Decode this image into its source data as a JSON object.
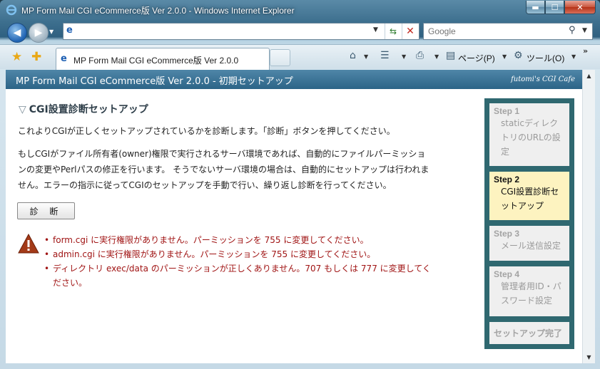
{
  "window": {
    "title": "MP Form Mail CGI eCommerce版 Ver 2.0.0 - Windows Internet Explorer",
    "controls": {
      "minimize": "▬",
      "maximize": "☐",
      "close": "✕"
    }
  },
  "nav": {
    "back_icon": "◀",
    "forward_icon": "▶",
    "address": {
      "value": ""
    },
    "search": {
      "placeholder": "Google"
    }
  },
  "tab": {
    "title": "MP Form Mail CGI eCommerce版 Ver 2.0.0"
  },
  "commands": {
    "page": "ページ(P)",
    "tools": "ツール(O)"
  },
  "banner": {
    "title": "MP Form Mail CGI eCommerce版 Ver 2.0.0 - 初期セットアップ",
    "brand": "futomi's CGI Cafe"
  },
  "main": {
    "heading": "CGI設置診断セットアップ",
    "intro": "これよりCGIが正しくセットアップされているかを診断します。「診断」ボタンを押してください。",
    "explanation_lines": [
      "もしCGIがファイル所有者(owner)権限で実行されるサーバ環境であれば、自動的にファイルパーミッショ",
      "ンの変更やPerlパスの修正を行います。 そうでないサーバ環境の場合は、自動的にセットアップは行われま",
      "せん。エラーの指示に従ってCGIのセットアップを手動で行い、繰り返し診断を行ってください。"
    ],
    "diagnose_button": "診 断",
    "errors": [
      "form.cgi に実行権限がありません。パーミッションを 755 に変更してください。",
      "admin.cgi に実行権限がありません。パーミッションを 755 に変更してください。",
      "ディレクトリ exec/data のパーミッションが正しくありません。707 もしくは 777 に変更してく",
      "ださい。"
    ]
  },
  "steps": [
    {
      "num": "Step 1",
      "lines": [
        "staticディレク",
        "トリのURLの設",
        "定"
      ],
      "active": false
    },
    {
      "num": "Step 2",
      "lines": [
        "CGI設置診断セ",
        "ットアップ"
      ],
      "active": true
    },
    {
      "num": "Step 3",
      "lines": [
        "メール送信設定"
      ],
      "active": false
    },
    {
      "num": "Step 4",
      "lines": [
        "管理者用ID・パ",
        "スワード設定"
      ],
      "active": false
    },
    {
      "num": "セットアップ完了",
      "lines": [],
      "active": false
    }
  ],
  "colors": {
    "banner": "#2c6487",
    "step_panel": "#2f6870",
    "step_active": "#fdf3c0",
    "error_text": "#a01414"
  }
}
